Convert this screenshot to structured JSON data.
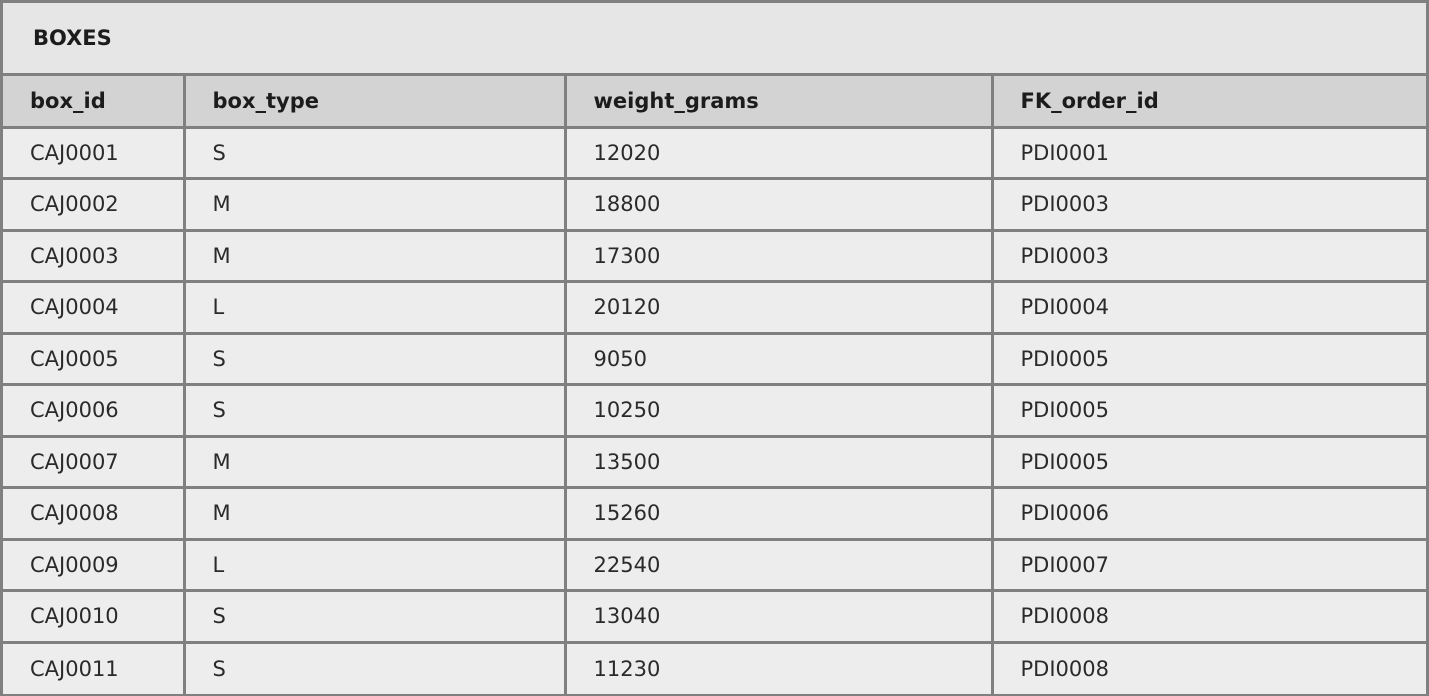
{
  "table": {
    "title": "BOXES",
    "columns": [
      "box_id",
      "box_type",
      "weight_grams",
      "FK_order_id"
    ],
    "rows": [
      [
        "CAJ0001",
        "S",
        "12020",
        "PDI0001"
      ],
      [
        "CAJ0002",
        "M",
        "18800",
        "PDI0003"
      ],
      [
        "CAJ0003",
        "M",
        "17300",
        "PDI0003"
      ],
      [
        "CAJ0004",
        "L",
        "20120",
        "PDI0004"
      ],
      [
        "CAJ0005",
        "S",
        "9050",
        "PDI0005"
      ],
      [
        "CAJ0006",
        "S",
        "10250",
        "PDI0005"
      ],
      [
        "CAJ0007",
        "M",
        "13500",
        "PDI0005"
      ],
      [
        "CAJ0008",
        "M",
        "15260",
        "PDI0006"
      ],
      [
        "CAJ0009",
        "L",
        "22540",
        "PDI0007"
      ],
      [
        "CAJ0010",
        "S",
        "13040",
        "PDI0008"
      ],
      [
        "CAJ0011",
        "S",
        "11230",
        "PDI0008"
      ]
    ]
  },
  "colors": {
    "border": "#808080",
    "header_bg": "#d3d3d3",
    "title_bg": "#e6e6e6",
    "cell_bg": "#ededed"
  }
}
